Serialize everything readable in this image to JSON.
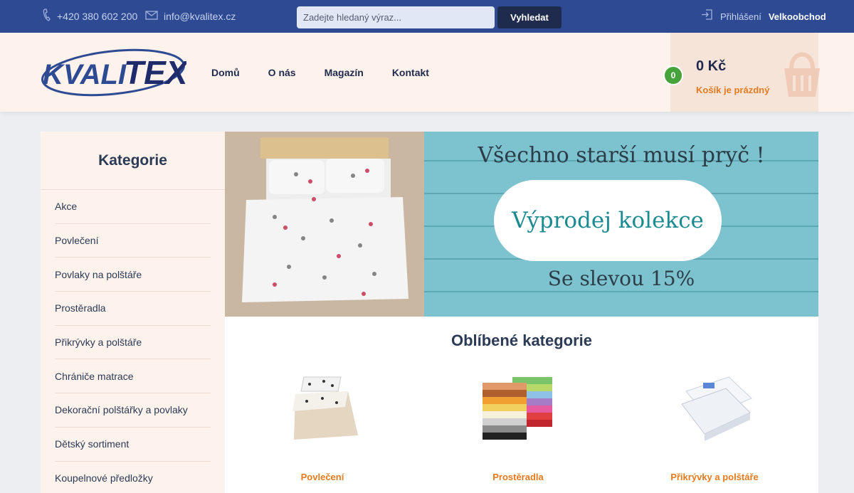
{
  "topbar": {
    "phone": "+420 380 602 200",
    "email": "info@kvalitex.cz",
    "search_placeholder": "Zadejte hledaný výraz...",
    "search_button": "Vyhledat",
    "login": "Přihlášení",
    "wholesale": "Velkoobchod",
    "icons": [
      "phone-icon",
      "envelope-icon",
      "login-icon"
    ]
  },
  "header": {
    "logo_text_left": "KVALI",
    "logo_text_right": "TEX",
    "nav": [
      "Domů",
      "O nás",
      "Magazín",
      "Kontakt"
    ],
    "cart": {
      "count": "0",
      "total": "0 Kč",
      "status": "Košík je prázdný"
    }
  },
  "sidebar": {
    "title": "Kategorie",
    "items": [
      "Akce",
      "Povlečení",
      "Povlaky na polštáře",
      "Prostěradla",
      "Přikrývky a polštáře",
      "Chrániče matrace",
      "Dekorační polštářky a povlaky",
      "Dětský sortiment",
      "Koupelnové předložky"
    ]
  },
  "banner": {
    "headline": "Všechno starší musí pryč !",
    "pill": "Výprodej kolekce",
    "sub": "Se slevou 15%"
  },
  "favorites": {
    "title": "Oblíbené kategorie",
    "items": [
      "Povlečení",
      "Prostěradla",
      "Přikrývky a polštáře"
    ]
  },
  "colors": {
    "topbar": "#2d4a93",
    "accent_orange": "#e67a1f",
    "cart_badge": "#46a23a",
    "header_bg": "#fdf2ec"
  }
}
